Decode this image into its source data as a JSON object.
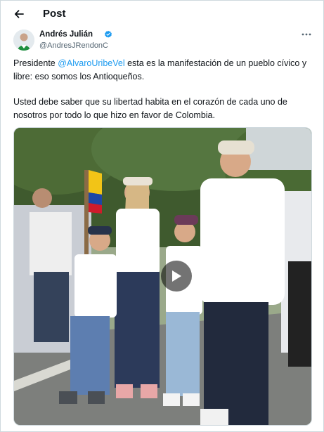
{
  "header": {
    "title": "Post",
    "back_icon": "arrow-left-icon"
  },
  "author": {
    "name": "Andrés Julián",
    "handle": "@AndresJRendonC",
    "verified_color": "#1d9bf0",
    "more_icon": "more-horizontal-icon"
  },
  "tweet": {
    "line1_prefix": "Presidente ",
    "mention": "@AlvaroUribeVel",
    "line1_suffix": " esta es la manifestación de un pueblo cívico y libre: eso somos los Antioqueños.",
    "paragraph2": "Usted debe saber que su libertad habita en el corazón de cada uno de nosotros por todo lo que hizo en favor de Colombia."
  },
  "media": {
    "type": "video",
    "play_icon": "play-icon"
  },
  "colors": {
    "accent": "#1d9bf0",
    "text": "#0f1419",
    "muted": "#536471"
  }
}
